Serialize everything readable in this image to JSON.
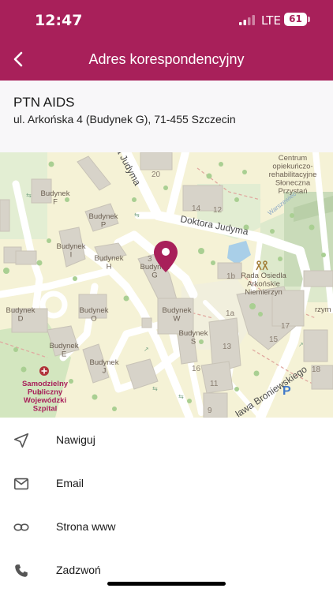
{
  "status_bar": {
    "time": "12:47",
    "network": "LTE",
    "battery": "61"
  },
  "header": {
    "title": "Adres korespondencyjny"
  },
  "place": {
    "name": "PTN AIDS",
    "address": "ul. Arkońska 4 (Budynek G), 71-455 Szczecin"
  },
  "map": {
    "labels": {
      "budynek_f": "Budynek\nF",
      "budynek_p": "Budynek\nP",
      "budynek_i": "Budynek\nI",
      "budynek_h": "Budynek\nH",
      "budynek_g": "Budynek\nG",
      "budynek_d": "Budynek\nD",
      "budynek_o": "Budynek\nO",
      "budynek_e": "Budynek\nE",
      "budynek_j": "Budynek\nJ",
      "budynek_w": "Budynek\nW",
      "budynek_s": "Budynek\nS",
      "street_judyma_diag": "a Judyma",
      "street_doktora_judyma": "Doktora Judyma",
      "street_bronewskiego": "ława Broniewskiego",
      "street_warszewiec": "Warszewiec",
      "poi_centrum": "Centrum\nopiekuńczo-\nrehabilitacyjne\nSłoneczna\nPrzystań",
      "poi_rada": "Rada Osiedla\nArkońskie\nNiemierzyn",
      "poi_szpital": "Samodzielny\nPubliczny\nWojewódzki\nSzpital",
      "partial_rzym": "rzym",
      "house_numbers": [
        "20",
        "14",
        "12",
        "1b",
        "1a",
        "17",
        "15",
        "13",
        "18",
        "11",
        "16",
        "9",
        "3"
      ]
    },
    "pin_color": "#a8205a"
  },
  "actions": [
    {
      "label": "Nawiguj",
      "icon": "navigation-arrow-icon"
    },
    {
      "label": "Email",
      "icon": "envelope-icon"
    },
    {
      "label": "Strona www",
      "icon": "link-icon"
    },
    {
      "label": "Zadzwoń",
      "icon": "phone-icon"
    }
  ]
}
